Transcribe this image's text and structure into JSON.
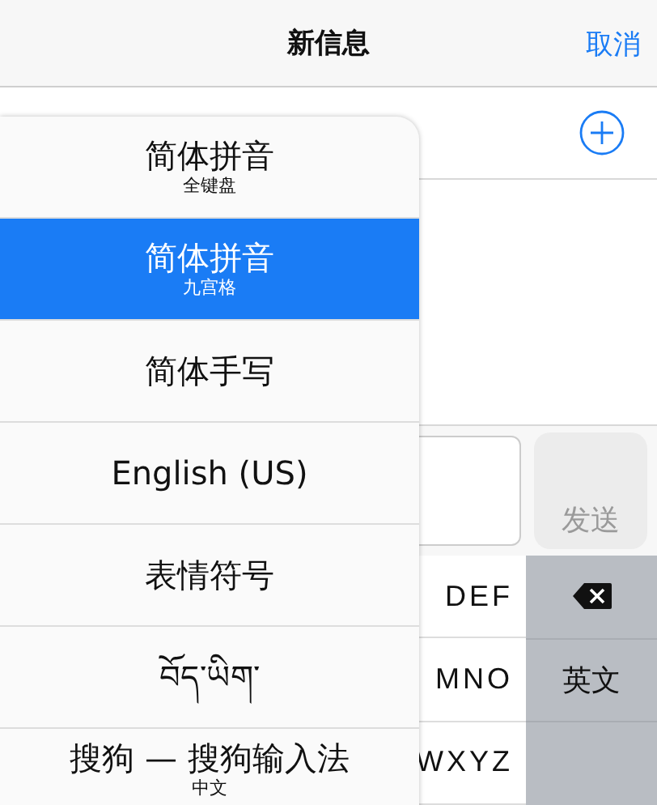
{
  "nav": {
    "title": "新信息",
    "cancel": "取消"
  },
  "composer": {
    "send": "发送"
  },
  "keyboard": {
    "keys": [
      {
        "label": "DEF"
      },
      {
        "label": "MNO"
      },
      {
        "label": "WXYZ"
      }
    ],
    "side_keys": [
      {
        "kind": "delete"
      },
      {
        "kind": "text",
        "label": "英文"
      },
      {
        "kind": "blank"
      }
    ]
  },
  "menu": [
    {
      "label": "简体拼音",
      "sublabel": "全键盘",
      "selected": false
    },
    {
      "label": "简体拼音",
      "sublabel": "九宫格",
      "selected": true
    },
    {
      "label": "简体手写",
      "selected": false
    },
    {
      "label": "English (US)",
      "selected": false
    },
    {
      "label": "表情符号",
      "selected": false
    },
    {
      "label": "བོད་ཡིག་",
      "selected": false
    },
    {
      "label": "搜狗 — 搜狗输入法",
      "sublabel": "中文",
      "selected": false
    }
  ]
}
